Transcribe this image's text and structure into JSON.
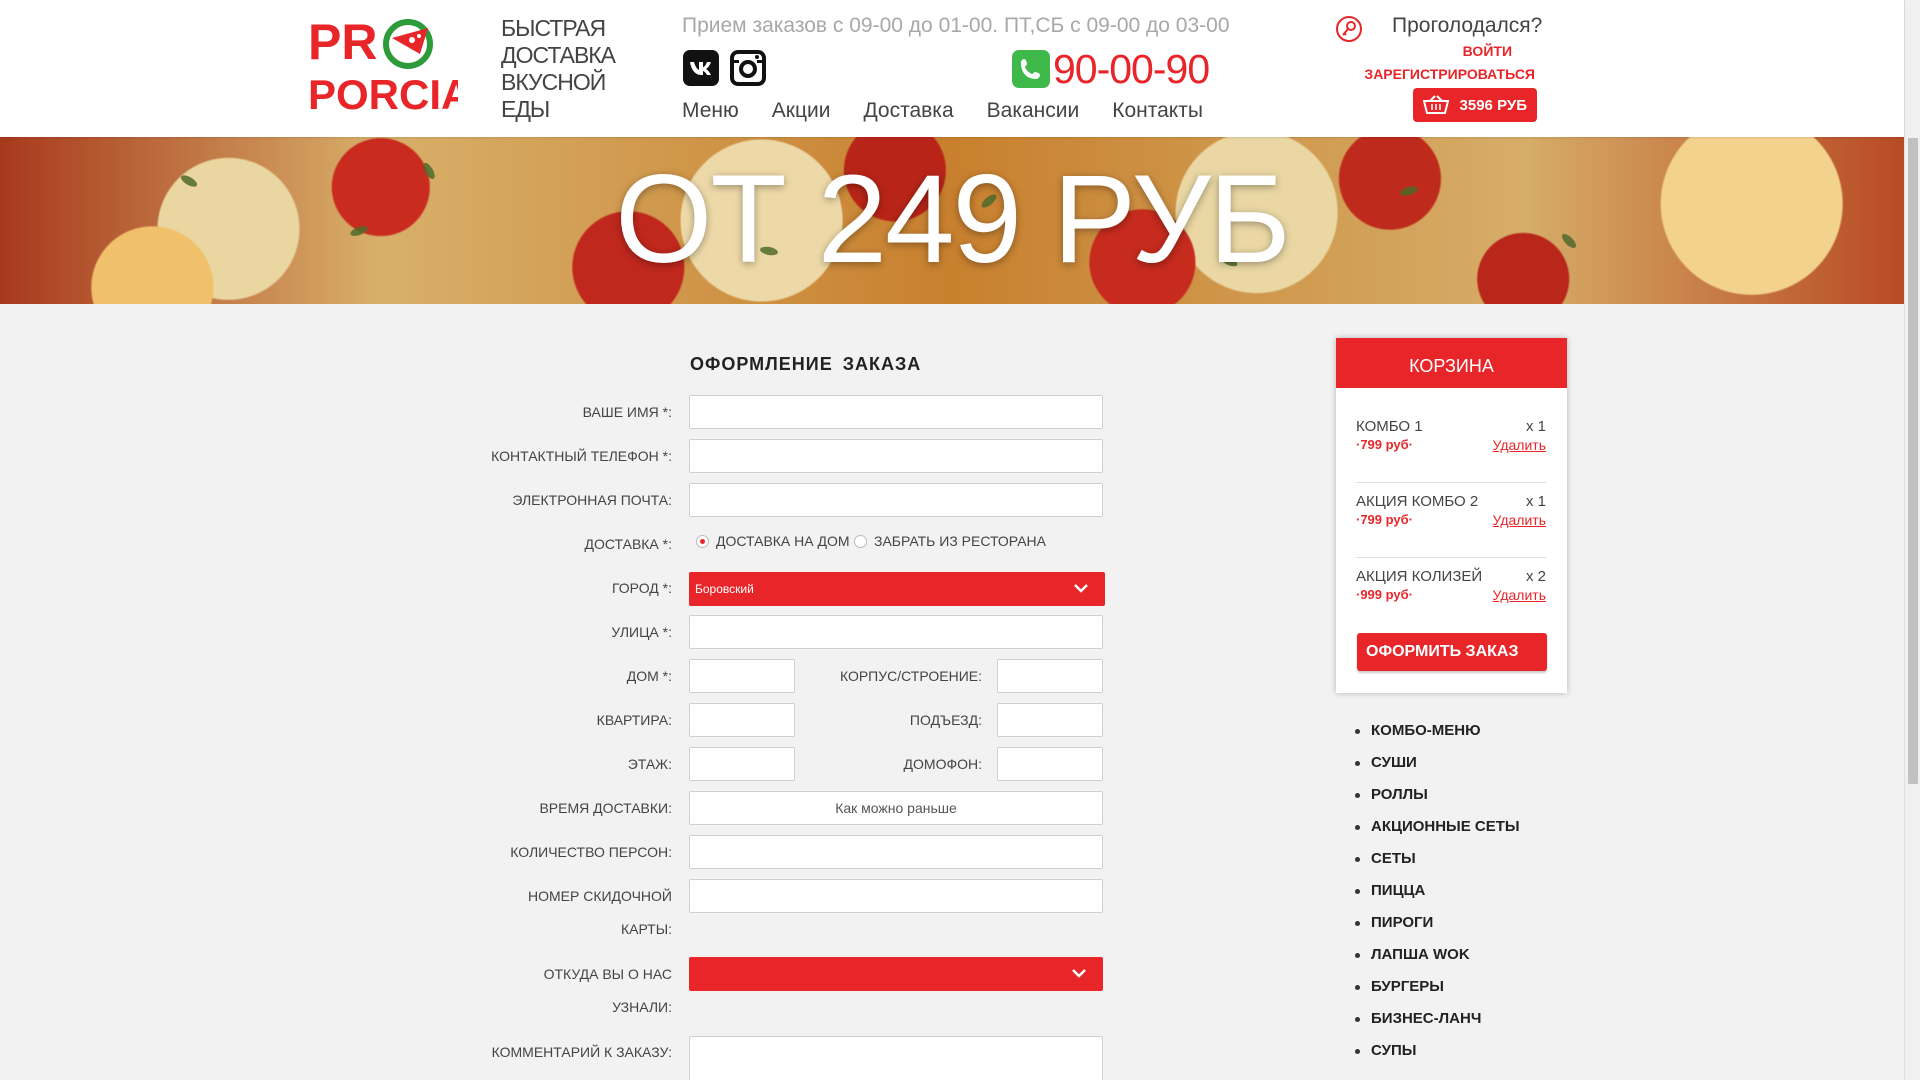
{
  "header": {
    "logo_text_top": "PR",
    "logo_text_bottom": "PORCIA",
    "tagline": "БЫСТРАЯ ДОСТАВКА ВКУСНОЙ ЕДЫ",
    "hours": "Прием заказов с 09-00 до 01-00. ПТ,СБ с 09-00 до 03-00",
    "phone": "90-00-90",
    "nav": [
      "Меню",
      "Акции",
      "Доставка",
      "Вакансии",
      "Контакты"
    ],
    "hungry": "Проголодался?",
    "login": "ВОЙТИ",
    "register": "ЗАРЕГИСТРИРОВАТЬСЯ",
    "cart_total": "3596 РУБ",
    "icons": [
      "vk-icon",
      "instagram-icon",
      "phone-icon",
      "key-icon",
      "basket-icon"
    ]
  },
  "banner": {
    "text": "ОТ 249 РУБ"
  },
  "form": {
    "title": "ОФОРМЛЕНИЕ ЗАКАЗА",
    "name_label": "ВАШЕ ИМЯ *:",
    "phone_label": "КОНТАКТНЫЙ ТЕЛЕФОН *:",
    "email_label": "ЭЛЕКТРОННАЯ ПОЧТА:",
    "delivery_label": "ДОСТАВКА *:",
    "delivery_options": [
      "ДОСТАВКА НА ДОМ",
      "ЗАБРАТЬ ИЗ РЕСТОРАНА"
    ],
    "delivery_selected": "ДОСТАВКА НА ДОМ",
    "city_label": "ГОРОД *:",
    "city_value": "Боровский",
    "street_label": "УЛИЦА *:",
    "house_label": "ДОМ *:",
    "building_label": "КОРПУС/СТРОЕНИЕ:",
    "apartment_label": "КВАРТИРА:",
    "entrance_label": "ПОДЪЕЗД:",
    "floor_label": "ЭТАЖ:",
    "intercom_label": "ДОМОФОН:",
    "time_label": "ВРЕМЯ ДОСТАВКИ:",
    "time_value": "Как можно раньше",
    "persons_label": "КОЛИЧЕСТВО ПЕРСОН:",
    "card_label_1": "НОМЕР СКИДОЧНОЙ",
    "card_label_2": "КАРТЫ:",
    "source_label_1": "ОТКУДА ВЫ О НАС",
    "source_label_2": "УЗНАЛИ:",
    "source_value": "",
    "comment_label": "КОММЕНТАРИЙ К ЗАКАЗУ:"
  },
  "cart": {
    "title": "КОРЗИНА",
    "items": [
      {
        "name": "КОМБО 1",
        "qty": "x 1",
        "price": "·799 руб·",
        "remove": "Удалить"
      },
      {
        "name": "АКЦИЯ КОМБО 2",
        "qty": "x 1",
        "price": "·799 руб·",
        "remove": "Удалить"
      },
      {
        "name": "АКЦИЯ КОЛИЗЕЙ",
        "qty": "x 2",
        "price": "·999 руб·",
        "remove": "Удалить"
      }
    ],
    "checkout": "ОФОРМИТЬ ЗАКАЗ"
  },
  "categories": [
    "КОМБО-МЕНЮ",
    "СУШИ",
    "РОЛЛЫ",
    "АКЦИОННЫЕ СЕТЫ",
    "СЕТЫ",
    "ПИЦЦА",
    "ПИРОГИ",
    "ЛАПША WOK",
    "БУРГЕРЫ",
    "БИЗНЕС-ЛАНЧ",
    "СУПЫ"
  ],
  "colors": {
    "accent": "#e8262a",
    "green": "#2e9b3a",
    "background": "#f2f2f2"
  }
}
